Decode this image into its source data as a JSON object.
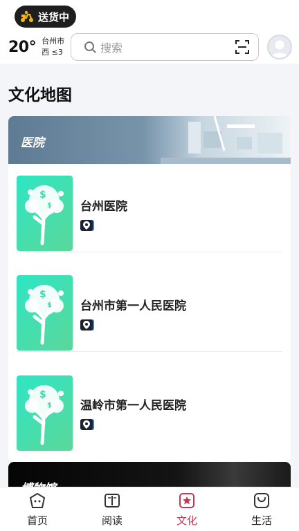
{
  "header": {
    "delivery_label": "送货中",
    "weather": {
      "temperature": "20°",
      "city": "台州市",
      "wind": "西 ≤3"
    },
    "search": {
      "placeholder": "搜索"
    }
  },
  "page_title": "文化地图",
  "categories": [
    {
      "label": "医院",
      "items": [
        {
          "name": "台州医院"
        },
        {
          "name": "台州市第一人民医院"
        },
        {
          "name": "温岭市第一人民医院"
        }
      ]
    },
    {
      "label": "博物馆"
    }
  ],
  "nav": {
    "tabs": [
      {
        "label": "首页",
        "icon": "home-icon",
        "active": false
      },
      {
        "label": "阅读",
        "icon": "book-icon",
        "active": false
      },
      {
        "label": "文化",
        "icon": "culture-icon",
        "active": true
      },
      {
        "label": "生活",
        "icon": "life-bag-icon",
        "active": false
      }
    ],
    "active_color": "#c23a52"
  },
  "colors": {
    "thumb_gradient_start": "#2ee6c4",
    "thumb_gradient_end": "#5bd79a",
    "accent": "#c23a52"
  }
}
